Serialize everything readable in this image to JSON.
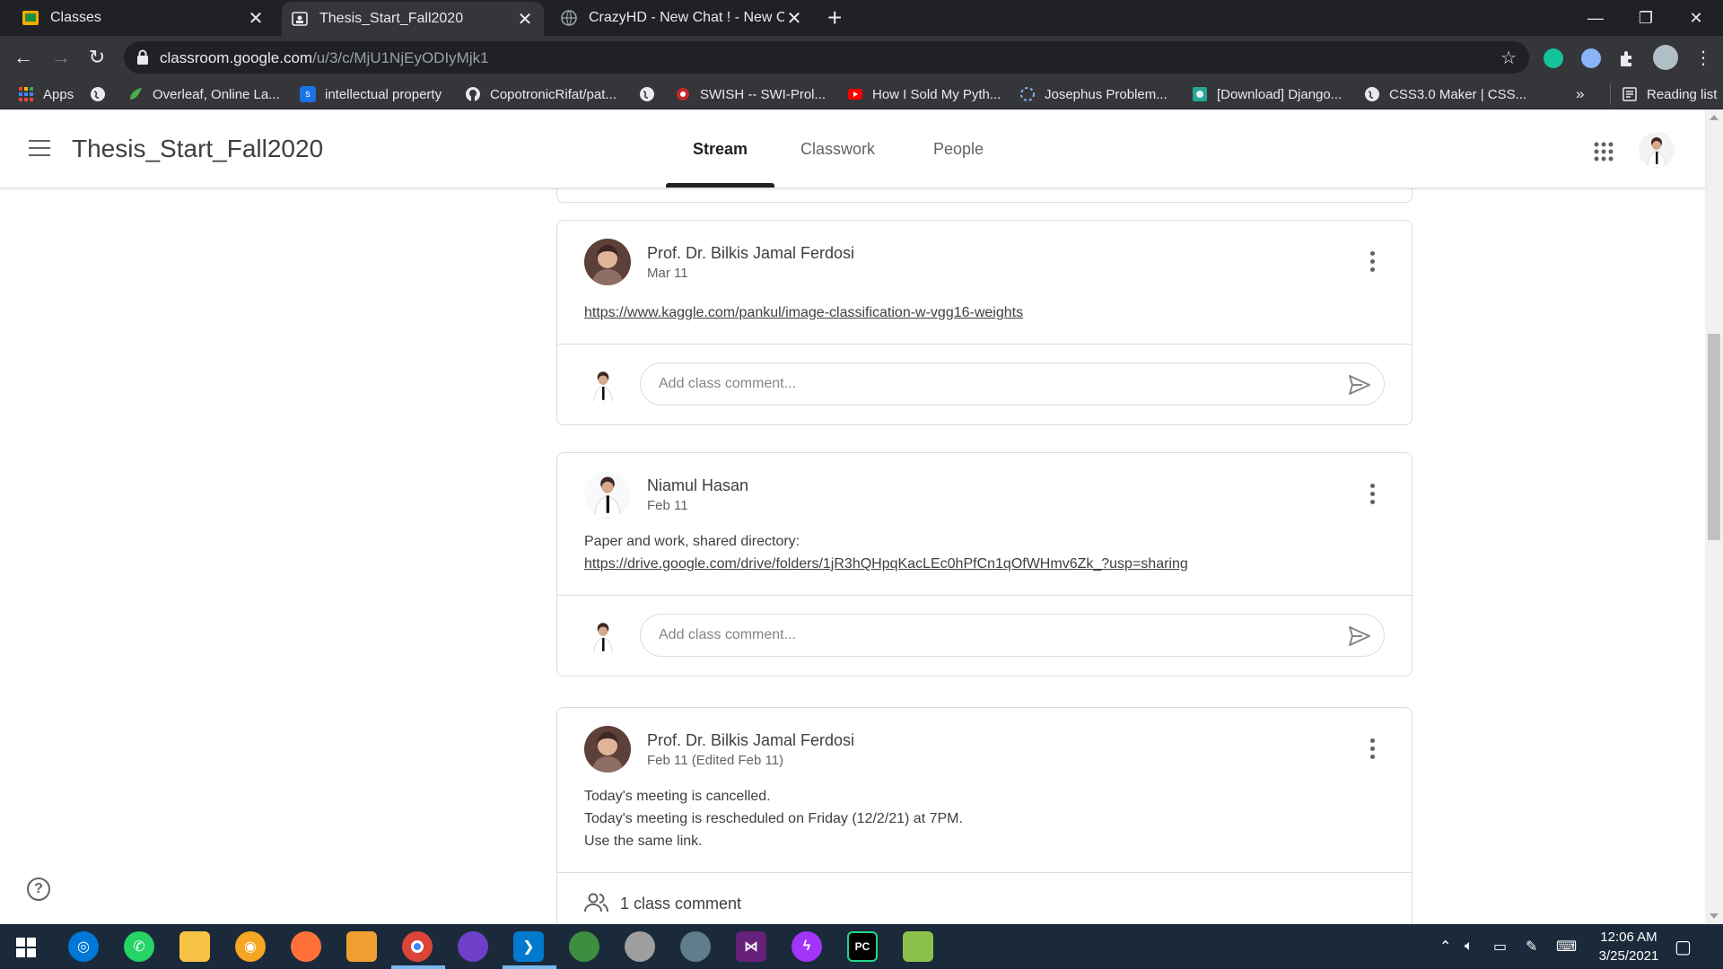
{
  "browser": {
    "tabs": [
      {
        "title": "Classes",
        "active": false
      },
      {
        "title": "Thesis_Start_Fall2020",
        "active": true
      },
      {
        "title": "CrazyHD - New Chat ! - New Cha",
        "active": false
      }
    ],
    "url_host": "classroom.google.com",
    "url_path": "/u/3/c/MjU1NjEyODIyMjk1",
    "bookmarks": [
      {
        "label": "Apps",
        "icon": "apps-grid-icon"
      },
      {
        "label": "",
        "icon": "globe-icon"
      },
      {
        "label": "Overleaf, Online La...",
        "icon": "overleaf-icon"
      },
      {
        "label": "intellectual property",
        "icon": "s-icon"
      },
      {
        "label": "CopotronicRifat/pat...",
        "icon": "github-icon"
      },
      {
        "label": "",
        "icon": "globe-icon"
      },
      {
        "label": "SWISH -- SWI-Prol...",
        "icon": "swish-icon"
      },
      {
        "label": "How I Sold My Pyth...",
        "icon": "youtube-icon"
      },
      {
        "label": "Josephus Problem...",
        "icon": "loading-icon"
      },
      {
        "label": "[Download] Django...",
        "icon": "image-icon"
      },
      {
        "label": "CSS3.0 Maker | CSS...",
        "icon": "globe-icon"
      }
    ],
    "more_bookmarks": "»",
    "reading_list": "Reading list"
  },
  "classroom": {
    "title": "Thesis_Start_Fall2020",
    "nav": [
      "Stream",
      "Classwork",
      "People"
    ],
    "active_nav": "Stream",
    "help": "?"
  },
  "posts": [
    {
      "author": "Prof. Dr. Bilkis Jamal Ferdosi",
      "date": "Mar 11",
      "lines": [],
      "link": "https://www.kaggle.com/pankul/image-classification-w-vgg16-weights",
      "comment_placeholder": "Add class comment..."
    },
    {
      "author": "Niamul Hasan",
      "date": "Feb 11",
      "lines": [
        "Paper and work, shared directory:"
      ],
      "link": "https://drive.google.com/drive/folders/1jR3hQHpqKacLEc0hPfCn1qOfWHmv6Zk_?usp=sharing",
      "comment_placeholder": "Add class comment..."
    },
    {
      "author": "Prof. Dr. Bilkis Jamal Ferdosi",
      "date": "Feb 11 (Edited Feb 11)",
      "lines": [
        "Today's meeting is cancelled.",
        "Today's meeting is rescheduled on Friday (12/2/21) at 7PM.",
        "Use the same link."
      ],
      "class_comments": "1 class comment"
    }
  ],
  "taskbar": {
    "time": "12:06 AM",
    "date": "3/25/2021"
  },
  "colors": {
    "chrome_dark": "#202124",
    "chrome_toolbar": "#35363a",
    "taskbar": "#1b2a3a",
    "text": "#3c4043"
  }
}
